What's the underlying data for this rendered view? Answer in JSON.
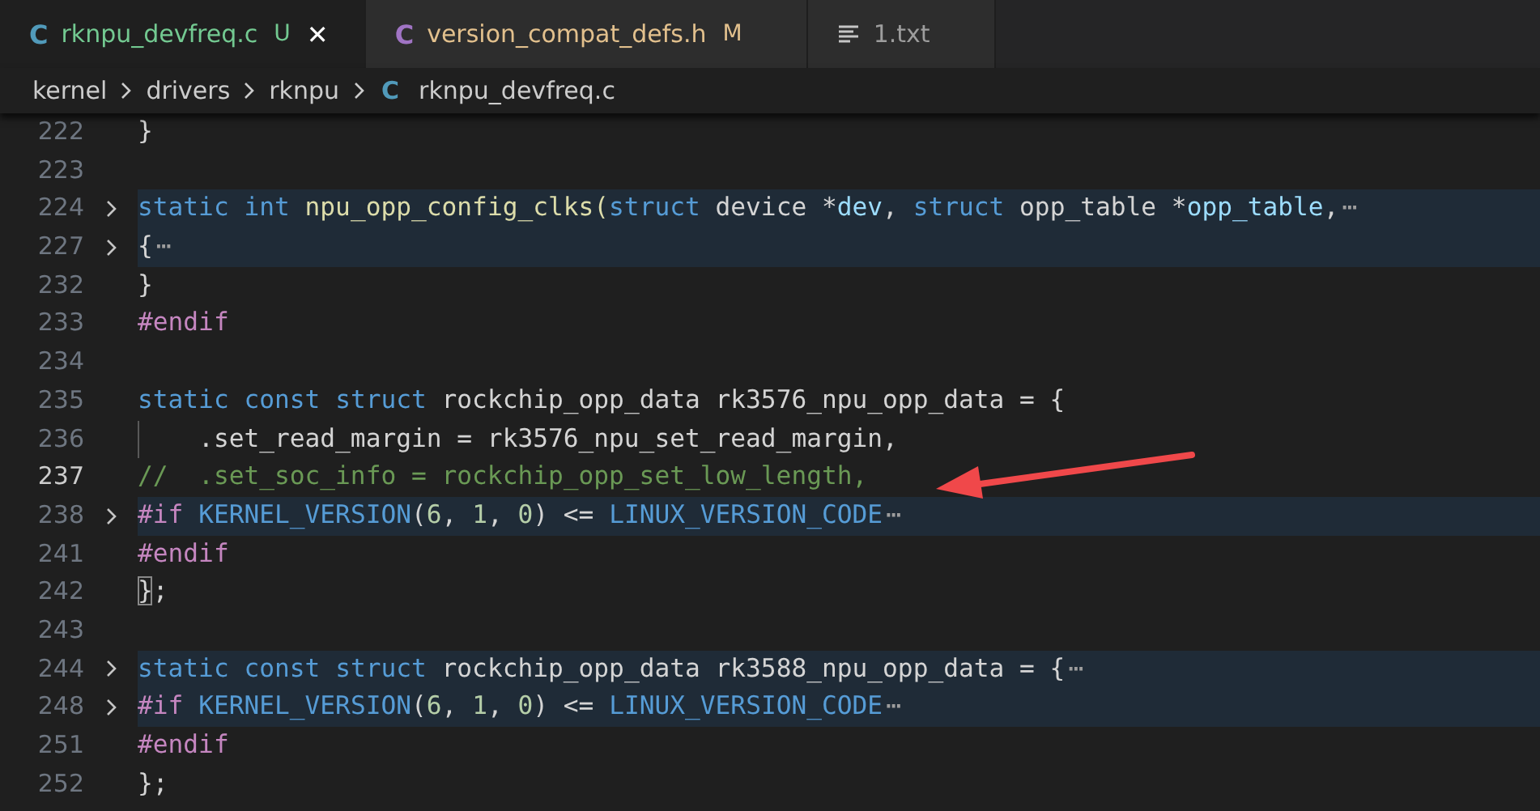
{
  "tabs": [
    {
      "icon": {
        "kind": "letter",
        "text": "C",
        "color": "#519aba"
      },
      "label": "rknpu_devfreq.c",
      "kind": "untracked",
      "badge": "U",
      "selected": true,
      "close": "✕"
    },
    {
      "icon": {
        "kind": "letter",
        "text": "C",
        "color": "#a074c4"
      },
      "label": "version_compat_defs.h",
      "kind": "modified",
      "badge": "M",
      "selected": false
    },
    {
      "icon": {
        "kind": "lines"
      },
      "label": "1.txt",
      "kind": "clean",
      "selected": false
    }
  ],
  "breadcrumb": [
    {
      "label": "kernel"
    },
    {
      "label": "drivers"
    },
    {
      "label": "rknpu"
    },
    {
      "icon": {
        "kind": "letter",
        "text": "C",
        "color": "#519aba"
      },
      "label": "rknpu_devfreq.c"
    }
  ],
  "lines": [
    {
      "number": "222",
      "folded": false,
      "current": false,
      "tokens": [
        {
          "kind": "plain",
          "t": "}"
        }
      ]
    },
    {
      "number": "223",
      "folded": false,
      "current": false
    },
    {
      "number": "224",
      "folded": true,
      "current": false,
      "tokens": [
        {
          "kind": "kw",
          "t": "static "
        },
        {
          "kind": "kw",
          "t": "int "
        },
        {
          "kind": "fn",
          "t": "npu_opp_config_clks("
        },
        {
          "kind": "kw",
          "t": "struct "
        },
        {
          "kind": "plain",
          "t": "device *"
        },
        {
          "kind": "var",
          "t": "dev"
        },
        {
          "kind": "plain",
          "t": ", "
        },
        {
          "kind": "kw",
          "t": "struct "
        },
        {
          "kind": "plain",
          "t": "opp_table *"
        },
        {
          "kind": "var",
          "t": "opp_table"
        },
        {
          "kind": "plain",
          "t": ","
        },
        {
          "kind": "fold",
          "t": "⋯"
        }
      ]
    },
    {
      "number": "227",
      "folded": true,
      "current": false,
      "tokens": [
        {
          "kind": "plain",
          "t": "{"
        },
        {
          "kind": "fold",
          "t": "⋯"
        }
      ]
    },
    {
      "number": "232",
      "folded": false,
      "current": false,
      "tokens": [
        {
          "kind": "plain",
          "t": "}"
        }
      ]
    },
    {
      "number": "233",
      "folded": false,
      "current": false,
      "tokens": [
        {
          "kind": "pre",
          "t": "#endif"
        }
      ]
    },
    {
      "number": "234",
      "folded": false,
      "current": false
    },
    {
      "number": "235",
      "folded": false,
      "current": false,
      "tokens": [
        {
          "kind": "kw",
          "t": "static "
        },
        {
          "kind": "kw",
          "t": "const "
        },
        {
          "kind": "kw",
          "t": "struct "
        },
        {
          "kind": "plain",
          "t": "rockchip_opp_data rk3576_npu_opp_data = {"
        }
      ]
    },
    {
      "number": "236",
      "folded": false,
      "current": false,
      "indent": true,
      "tokens": [
        {
          "kind": "plain",
          "t": "    .set_read_margin = rk3576_npu_set_read_margin,"
        }
      ]
    },
    {
      "number": "237",
      "folded": false,
      "current": true,
      "tokens": [
        {
          "kind": "cmt",
          "t": "//  .set_soc_info = rockchip_opp_set_low_length,"
        }
      ]
    },
    {
      "number": "238",
      "folded": true,
      "current": false,
      "tokens": [
        {
          "kind": "pre",
          "t": "#if "
        },
        {
          "kind": "macro",
          "t": "KERNEL_VERSION"
        },
        {
          "kind": "plain",
          "t": "("
        },
        {
          "kind": "num",
          "t": "6"
        },
        {
          "kind": "plain",
          "t": ", "
        },
        {
          "kind": "num",
          "t": "1"
        },
        {
          "kind": "plain",
          "t": ", "
        },
        {
          "kind": "num",
          "t": "0"
        },
        {
          "kind": "plain",
          "t": ") <= "
        },
        {
          "kind": "macro",
          "t": "LINUX_VERSION_CODE"
        },
        {
          "kind": "fold",
          "t": "⋯"
        }
      ]
    },
    {
      "number": "241",
      "folded": false,
      "current": false,
      "tokens": [
        {
          "kind": "pre",
          "t": "#endif"
        }
      ]
    },
    {
      "number": "242",
      "folded": false,
      "current": false,
      "tokens": [
        {
          "kind": "bracket",
          "t": "}"
        },
        {
          "kind": "plain",
          "t": ";"
        }
      ]
    },
    {
      "number": "243",
      "folded": false,
      "current": false
    },
    {
      "number": "244",
      "folded": true,
      "current": false,
      "tokens": [
        {
          "kind": "kw",
          "t": "static "
        },
        {
          "kind": "kw",
          "t": "const "
        },
        {
          "kind": "kw",
          "t": "struct "
        },
        {
          "kind": "plain",
          "t": "rockchip_opp_data rk3588_npu_opp_data = {"
        },
        {
          "kind": "fold",
          "t": "⋯"
        }
      ]
    },
    {
      "number": "248",
      "folded": true,
      "current": false,
      "tokens": [
        {
          "kind": "pre",
          "t": "#if "
        },
        {
          "kind": "macro",
          "t": "KERNEL_VERSION"
        },
        {
          "kind": "plain",
          "t": "("
        },
        {
          "kind": "num",
          "t": "6"
        },
        {
          "kind": "plain",
          "t": ", "
        },
        {
          "kind": "num",
          "t": "1"
        },
        {
          "kind": "plain",
          "t": ", "
        },
        {
          "kind": "num",
          "t": "0"
        },
        {
          "kind": "plain",
          "t": ") <= "
        },
        {
          "kind": "macro",
          "t": "LINUX_VERSION_CODE"
        },
        {
          "kind": "fold",
          "t": "⋯"
        }
      ]
    },
    {
      "number": "251",
      "folded": false,
      "current": false,
      "tokens": [
        {
          "kind": "pre",
          "t": "#endif"
        }
      ]
    },
    {
      "number": "252",
      "folded": false,
      "current": false,
      "tokens": [
        {
          "kind": "plain",
          "t": "};"
        }
      ]
    }
  ]
}
